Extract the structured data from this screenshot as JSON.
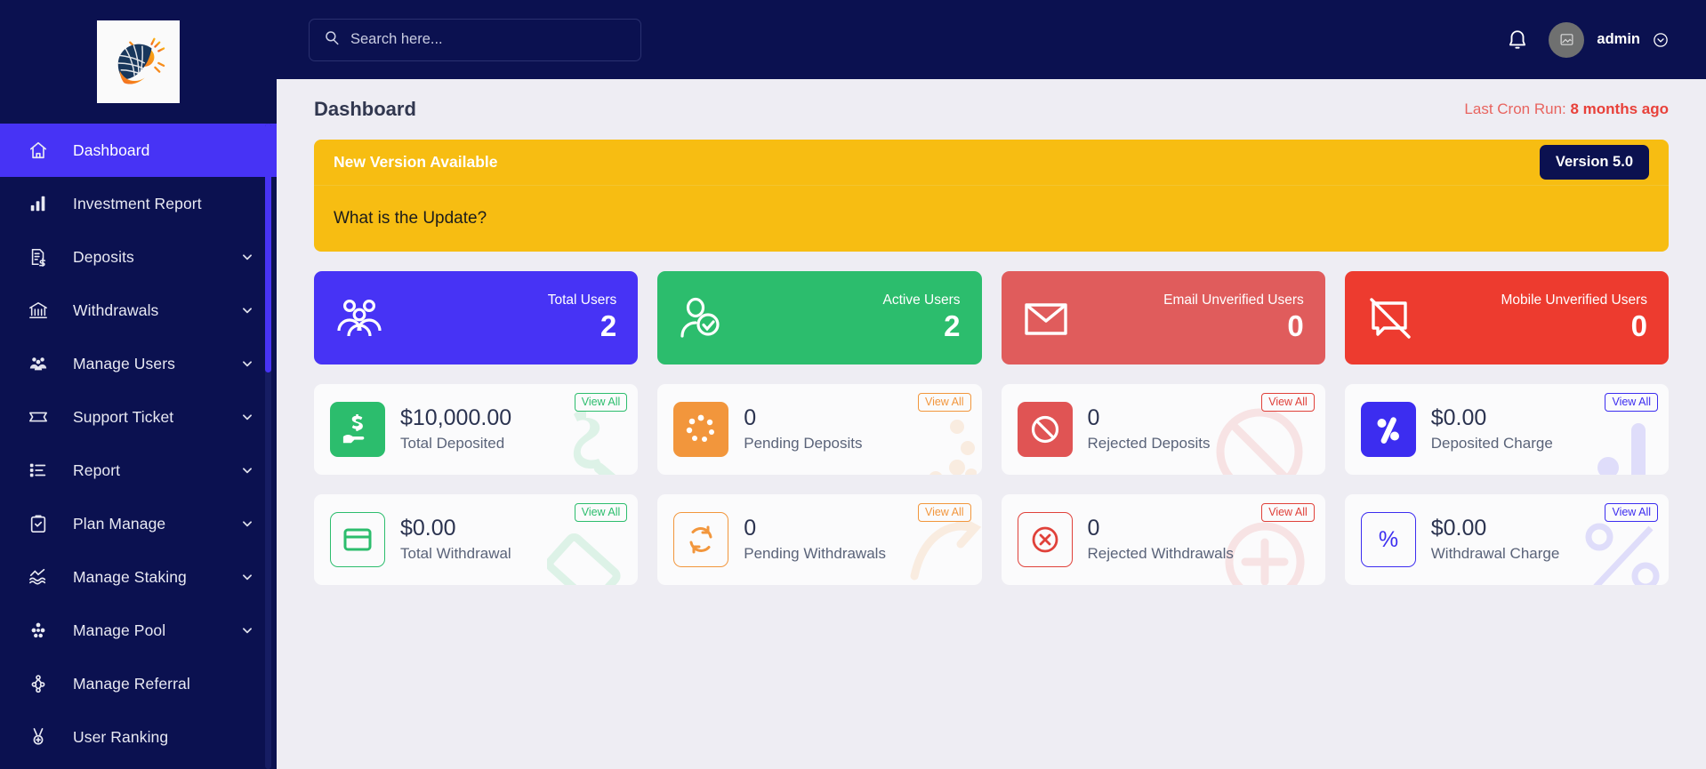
{
  "brand": {
    "logo_icon": "solar-sun-logo"
  },
  "sidebar": {
    "items": [
      {
        "label": "Dashboard",
        "icon": "home-icon",
        "active": true,
        "caret": false
      },
      {
        "label": "Investment Report",
        "icon": "bar-chart-icon",
        "active": false,
        "caret": false
      },
      {
        "label": "Deposits",
        "icon": "invoice-dollar-icon",
        "active": false,
        "caret": true
      },
      {
        "label": "Withdrawals",
        "icon": "bank-icon",
        "active": false,
        "caret": true
      },
      {
        "label": "Manage Users",
        "icon": "users-group-icon",
        "active": false,
        "caret": true
      },
      {
        "label": "Support Ticket",
        "icon": "ticket-icon",
        "active": false,
        "caret": true
      },
      {
        "label": "Report",
        "icon": "list-icon",
        "active": false,
        "caret": true
      },
      {
        "label": "Plan Manage",
        "icon": "clipboard-check-icon",
        "active": false,
        "caret": true
      },
      {
        "label": "Manage Staking",
        "icon": "staking-wave-icon",
        "active": false,
        "caret": true
      },
      {
        "label": "Manage Pool",
        "icon": "pool-cubes-icon",
        "active": false,
        "caret": true
      },
      {
        "label": "Manage Referral",
        "icon": "referral-tree-icon",
        "active": false,
        "caret": false
      },
      {
        "label": "User Ranking",
        "icon": "medal-icon",
        "active": false,
        "caret": false
      }
    ]
  },
  "topbar": {
    "search": {
      "placeholder": "Search here...",
      "value": "",
      "icon": "search-icon"
    },
    "notification_icon": "bell-icon",
    "avatar_icon": "broken-image-icon",
    "user_name": "admin",
    "user_caret_icon": "chevron-down-circle-icon"
  },
  "page": {
    "title": "Dashboard",
    "cron_prefix": "Last Cron Run: ",
    "cron_value": "8 months ago"
  },
  "banner": {
    "title": "New Version Available",
    "question": "What is the Update?",
    "version_label": "Version 5.0",
    "bg_color": "#f7bd12",
    "badge_color": "#0b1150"
  },
  "stats": [
    {
      "label": "Total Users",
      "value": "2",
      "color": "#4733f5",
      "icon": "users-group-icon"
    },
    {
      "label": "Active Users",
      "value": "2",
      "color": "#2cbd6d",
      "icon": "user-check-icon"
    },
    {
      "label": "Email Unverified Users",
      "value": "0",
      "color": "#e05c5c",
      "icon": "envelope-icon"
    },
    {
      "label": "Mobile Unverified Users",
      "value": "0",
      "color": "#ed3b2f",
      "icon": "mobile-slash-icon"
    }
  ],
  "cards": [
    {
      "value": "$10,000.00",
      "label": "Total Deposited",
      "view_all": "View All",
      "color": "#2cbd6d",
      "style": "filled",
      "icon": "hand-cash-icon",
      "watermark": "dollar-wm"
    },
    {
      "value": "0",
      "label": "Pending Deposits",
      "view_all": "View All",
      "color": "#f2963c",
      "style": "filled",
      "icon": "spinner-dots-icon",
      "watermark": "dots-wm"
    },
    {
      "value": "0",
      "label": "Rejected Deposits",
      "view_all": "View All",
      "color": "#e05454",
      "style": "filled",
      "icon": "ban-icon",
      "watermark": "ban-wm"
    },
    {
      "value": "$0.00",
      "label": "Deposited Charge",
      "view_all": "View All",
      "color": "#3c2df0",
      "style": "filled",
      "icon": "percent-dots-icon",
      "watermark": "bars-wm"
    },
    {
      "value": "$0.00",
      "label": "Total Withdrawal",
      "view_all": "View All",
      "color": "#2cbd6d",
      "style": "outline",
      "icon": "card-icon",
      "watermark": "card-wm"
    },
    {
      "value": "0",
      "label": "Pending Withdrawals",
      "view_all": "View All",
      "color": "#f2963c",
      "style": "outline",
      "icon": "refresh-icon",
      "watermark": "arrow-wm"
    },
    {
      "value": "0",
      "label": "Rejected Withdrawals",
      "view_all": "View All",
      "color": "#e0413a",
      "style": "outline",
      "icon": "circle-x-icon",
      "watermark": "plus-wm"
    },
    {
      "value": "$0.00",
      "label": "Withdrawal Charge",
      "view_all": "View All",
      "color": "#3c2df0",
      "style": "outline",
      "icon": "percent-icon",
      "watermark": "percent-wm"
    }
  ]
}
